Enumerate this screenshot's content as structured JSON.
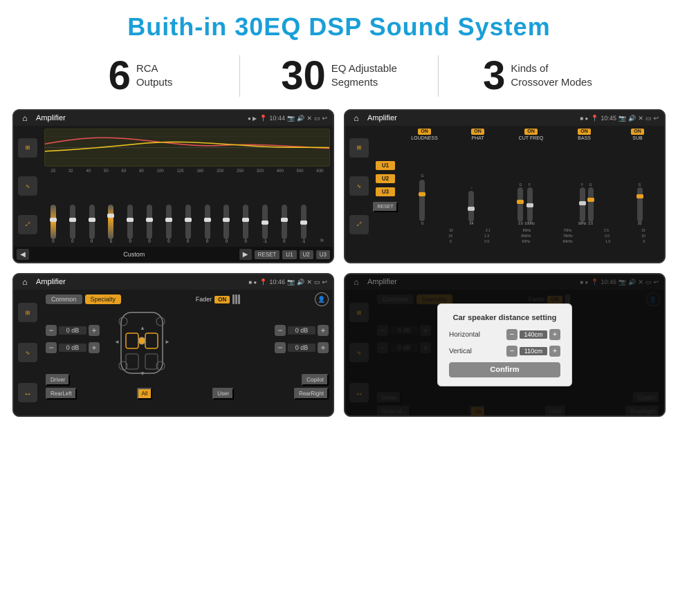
{
  "page": {
    "title": "Buith-in 30EQ DSP Sound System",
    "stats": [
      {
        "number": "6",
        "text_line1": "RCA",
        "text_line2": "Outputs"
      },
      {
        "number": "30",
        "text_line1": "EQ Adjustable",
        "text_line2": "Segments"
      },
      {
        "number": "3",
        "text_line1": "Kinds of",
        "text_line2": "Crossover Modes"
      }
    ]
  },
  "screens": {
    "screen1": {
      "title": "Amplifier",
      "time": "10:44",
      "eq_freqs": [
        "25",
        "32",
        "40",
        "50",
        "63",
        "80",
        "100",
        "125",
        "160",
        "200",
        "250",
        "320",
        "400",
        "500",
        "630"
      ],
      "eq_values": [
        "0",
        "0",
        "0",
        "5",
        "0",
        "0",
        "0",
        "0",
        "0",
        "0",
        "0",
        "-1",
        "0",
        "-1"
      ],
      "preset_label": "Custom",
      "buttons": [
        "RESET",
        "U1",
        "U2",
        "U3"
      ]
    },
    "screen2": {
      "title": "Amplifier",
      "time": "10:45",
      "presets": [
        "U1",
        "U2",
        "U3"
      ],
      "controls": [
        "LOUDNESS",
        "PHAT",
        "CUT FREQ",
        "BASS",
        "SUB"
      ],
      "reset_label": "RESET"
    },
    "screen3": {
      "title": "Amplifier",
      "time": "10:46",
      "tabs": [
        "Common",
        "Specialty"
      ],
      "fader_label": "Fader",
      "fader_on": "ON",
      "volumes": [
        "0 dB",
        "0 dB",
        "0 dB",
        "0 dB"
      ],
      "buttons": {
        "driver": "Driver",
        "copilot": "Copilot",
        "rear_left": "RearLeft",
        "all": "All",
        "user": "User",
        "rear_right": "RearRight"
      }
    },
    "screen4": {
      "title": "Amplifier",
      "time": "10:46",
      "tabs": [
        "Common",
        "Specialty"
      ],
      "dialog": {
        "title": "Car speaker distance setting",
        "horizontal_label": "Horizontal",
        "horizontal_value": "140cm",
        "vertical_label": "Vertical",
        "vertical_value": "110cm",
        "confirm_label": "Confirm"
      },
      "volumes": [
        "0 dB",
        "0 dB"
      ],
      "buttons": {
        "driver": "Driver",
        "copilot": "Copilot",
        "rear_left": "RearLef...",
        "all": "All",
        "user": "User",
        "rear_right": "RearRight"
      }
    }
  },
  "icons": {
    "home": "⌂",
    "pin": "📍",
    "speaker": "🔊",
    "back": "↩",
    "menu": "≡",
    "eq_adjust": "⊞",
    "wave": "∿",
    "expand": "⤢",
    "play": "▶",
    "prev": "◀",
    "next": "▶",
    "chevron_up": "▲",
    "chevron_down": "▼",
    "chevron_left": "◄",
    "chevron_right": "►",
    "minus": "−",
    "plus": "+"
  }
}
